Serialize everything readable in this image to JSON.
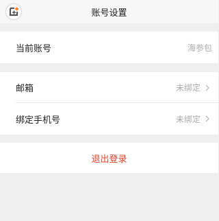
{
  "header": {
    "title": "账号设置",
    "back_icon": "back-icon"
  },
  "account": {
    "label": "当前账号",
    "value": "海参包"
  },
  "email": {
    "label": "邮箱",
    "value": "未绑定"
  },
  "phone": {
    "label": "绑定手机号",
    "value": "未绑定"
  },
  "logout": {
    "label": "退出登录"
  },
  "colors": {
    "accent": "#e8412c",
    "background": "#efefef"
  }
}
